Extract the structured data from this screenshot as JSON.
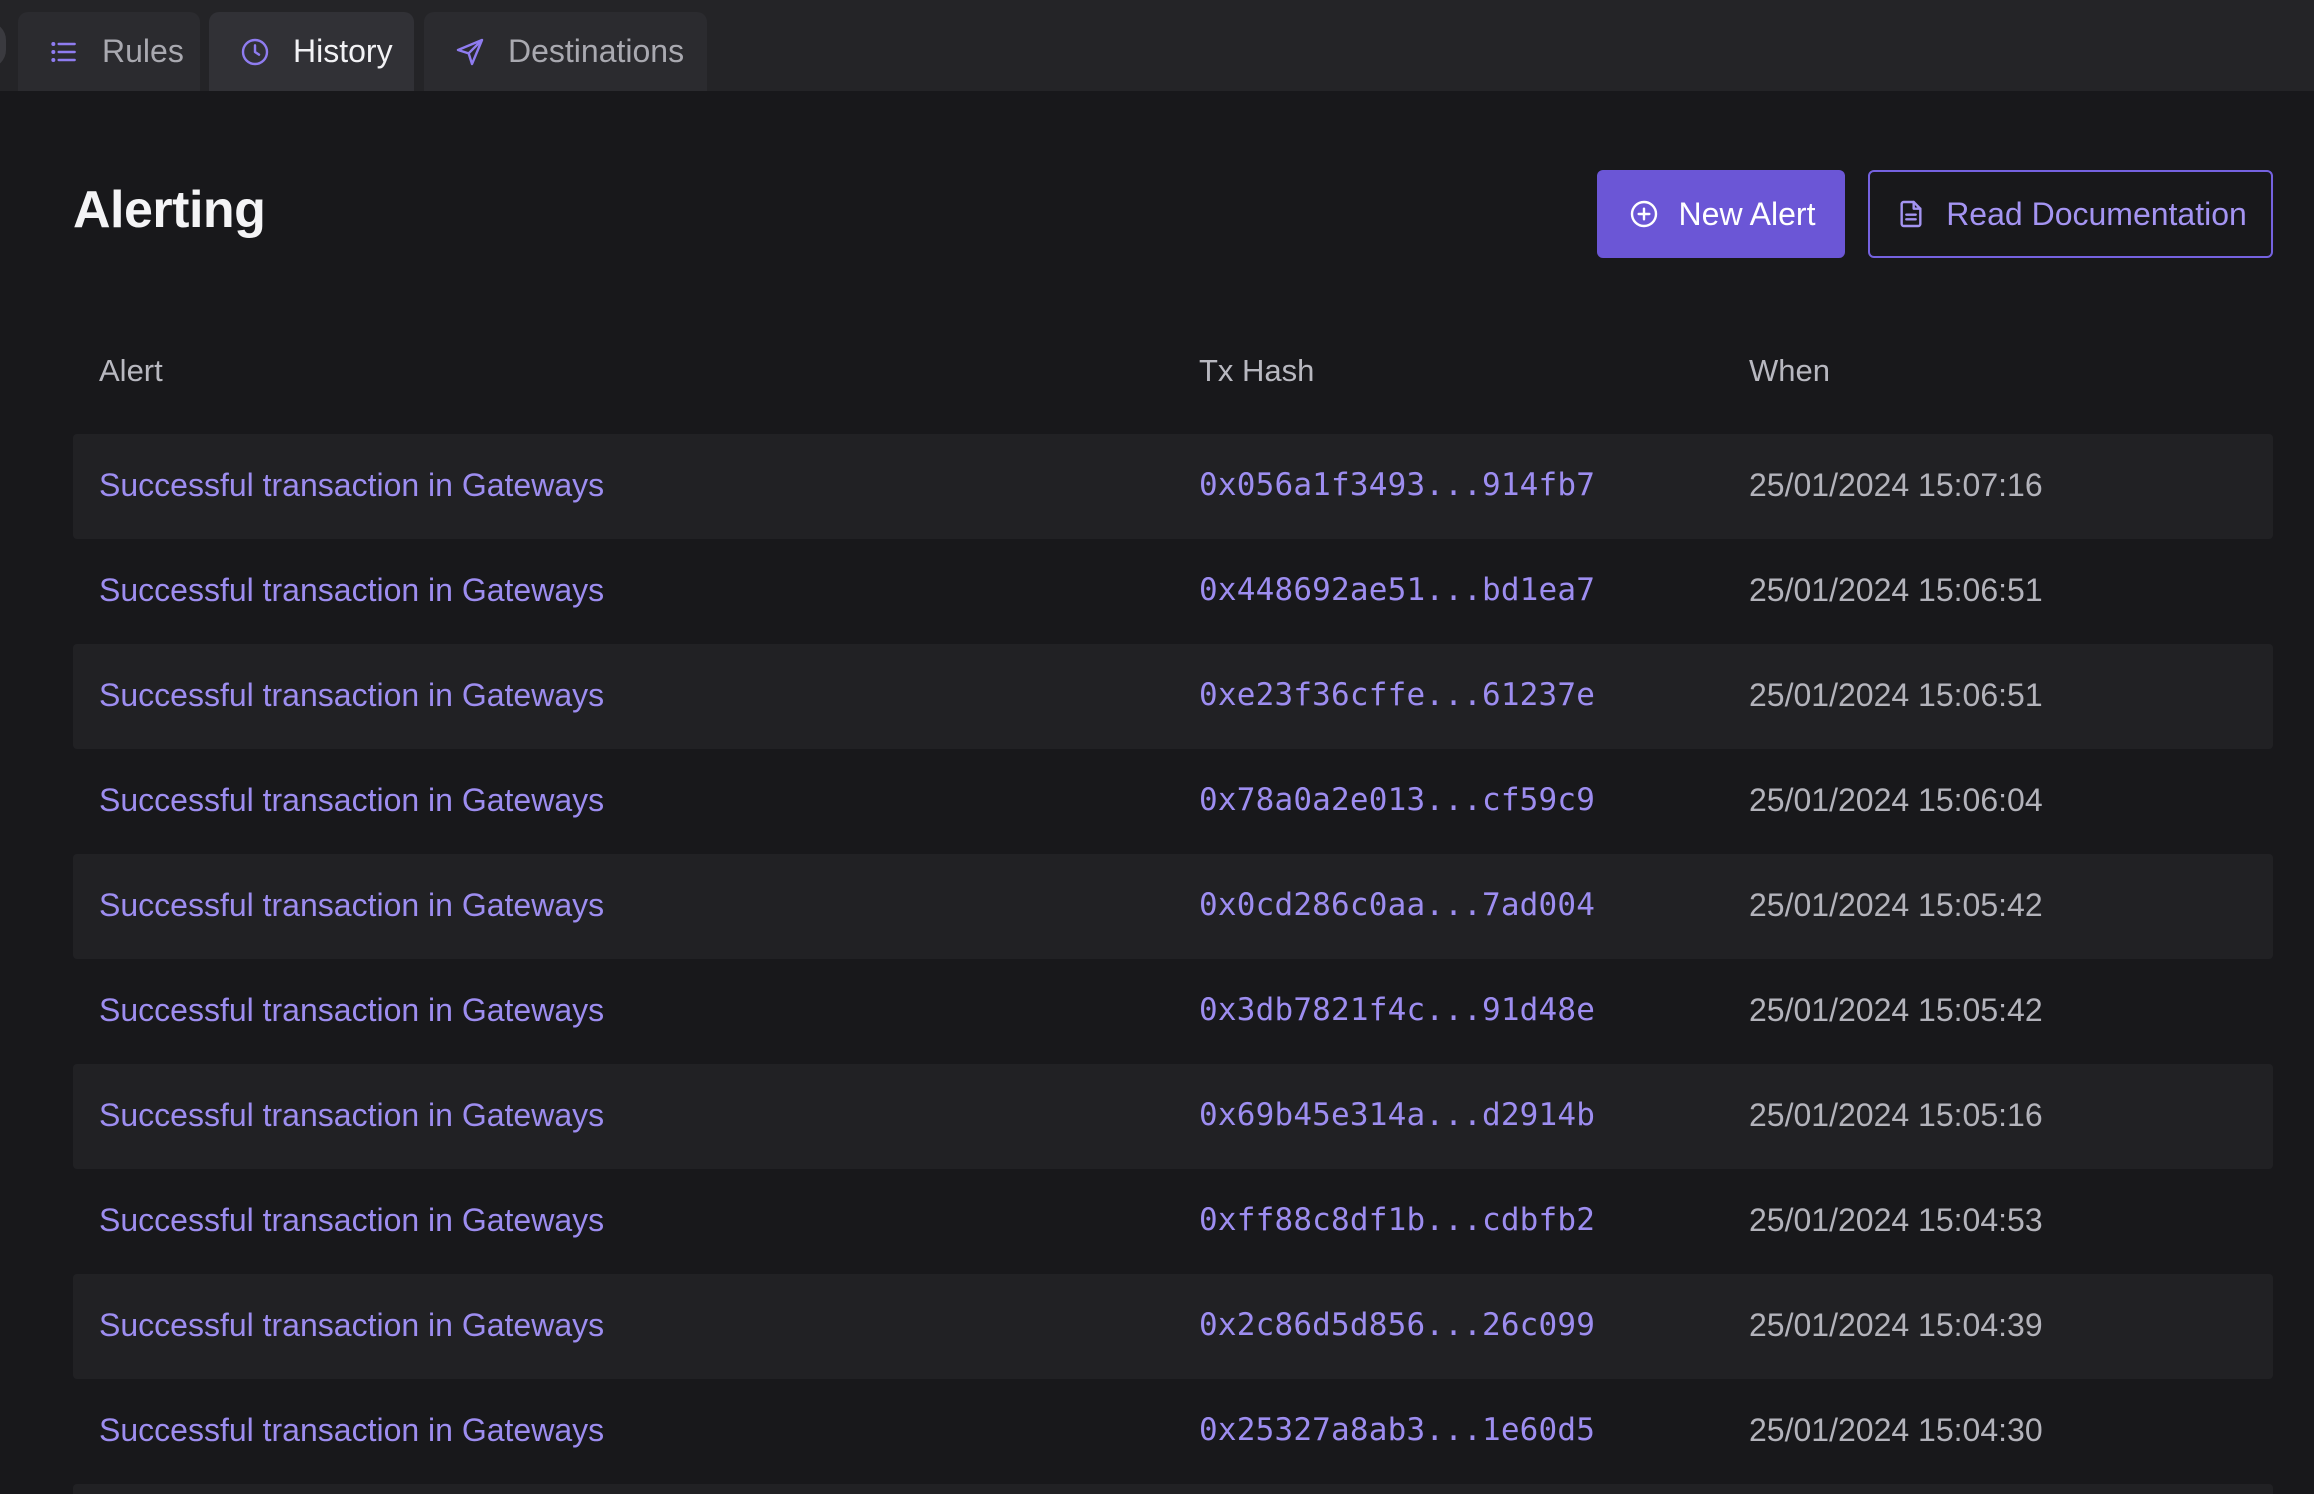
{
  "tabs": [
    {
      "label": "Rules",
      "icon": "list-icon",
      "active": false
    },
    {
      "label": "History",
      "icon": "clock-icon",
      "active": true
    },
    {
      "label": "Destinations",
      "icon": "send-icon",
      "active": false
    }
  ],
  "header": {
    "title": "Alerting",
    "new_alert_label": "New Alert",
    "new_alert_icon": "plus-circle-icon",
    "docs_label": "Read Documentation",
    "docs_icon": "document-icon"
  },
  "table": {
    "columns": [
      "Alert",
      "Tx Hash",
      "When"
    ],
    "rows": [
      {
        "alert": "Successful transaction in Gateways",
        "hash": "0x056a1f3493...914fb7",
        "when": "25/01/2024 15:07:16"
      },
      {
        "alert": "Successful transaction in Gateways",
        "hash": "0x448692ae51...bd1ea7",
        "when": "25/01/2024 15:06:51"
      },
      {
        "alert": "Successful transaction in Gateways",
        "hash": "0xe23f36cffe...61237e",
        "when": "25/01/2024 15:06:51"
      },
      {
        "alert": "Successful transaction in Gateways",
        "hash": "0x78a0a2e013...cf59c9",
        "when": "25/01/2024 15:06:04"
      },
      {
        "alert": "Successful transaction in Gateways",
        "hash": "0x0cd286c0aa...7ad004",
        "when": "25/01/2024 15:05:42"
      },
      {
        "alert": "Successful transaction in Gateways",
        "hash": "0x3db7821f4c...91d48e",
        "when": "25/01/2024 15:05:42"
      },
      {
        "alert": "Successful transaction in Gateways",
        "hash": "0x69b45e314a...d2914b",
        "when": "25/01/2024 15:05:16"
      },
      {
        "alert": "Successful transaction in Gateways",
        "hash": "0xff88c8df1b...cdbfb2",
        "when": "25/01/2024 15:04:53"
      },
      {
        "alert": "Successful transaction in Gateways",
        "hash": "0x2c86d5d856...26c099",
        "when": "25/01/2024 15:04:39"
      },
      {
        "alert": "Successful transaction in Gateways",
        "hash": "0x25327a8ab3...1e60d5",
        "when": "25/01/2024 15:04:30"
      }
    ]
  },
  "colors": {
    "accent": "#6b56d6",
    "link": "#9d8df0",
    "background": "#18181b"
  }
}
